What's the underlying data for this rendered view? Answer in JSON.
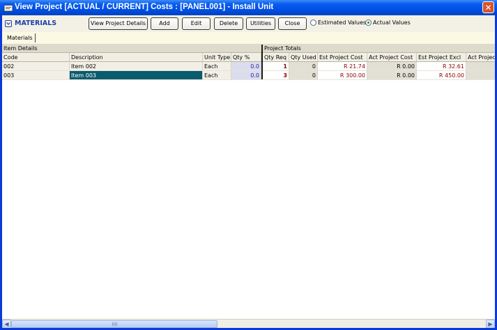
{
  "window": {
    "title": "View Project [ACTUAL / CURRENT] Costs : [PANEL001] - Install Unit"
  },
  "toolbar": {
    "section_title": "MATERIALS",
    "buttons": {
      "view_details": "View Project Details",
      "add": "Add",
      "edit": "Edit",
      "delete": "Delete",
      "utilities": "Utilities",
      "close": "Close"
    },
    "radio": {
      "estimated": "Estimated Values",
      "actual": "Actual Values",
      "selected": "actual"
    }
  },
  "tabs": {
    "materials": "Materials"
  },
  "grid": {
    "group_item": "Item Details",
    "group_totals": "Project Totals",
    "columns": [
      "Code",
      "Description",
      "Unit Type",
      "Qty %",
      "Qty Req",
      "Qty Used",
      "Est Project Cost",
      "Act Project Cost",
      "Est Project Excl",
      "Act Project"
    ],
    "rows": [
      {
        "code": "002",
        "description": "Item 002",
        "unit_type": "Each",
        "qty_pct": "0.0",
        "qty_req": "1",
        "qty_used": "0",
        "est_cost": "R 21.74",
        "act_cost": "R 0.00",
        "est_excl": "R 32.61",
        "act_excl": ""
      },
      {
        "code": "003",
        "description": "Item 003",
        "unit_type": "Each",
        "qty_pct": "0.0",
        "qty_req": "3",
        "qty_used": "0",
        "est_cost": "R 300.00",
        "act_cost": "R 0.00",
        "est_excl": "R 450.00",
        "act_excl": ""
      }
    ],
    "selected_row": 1
  }
}
